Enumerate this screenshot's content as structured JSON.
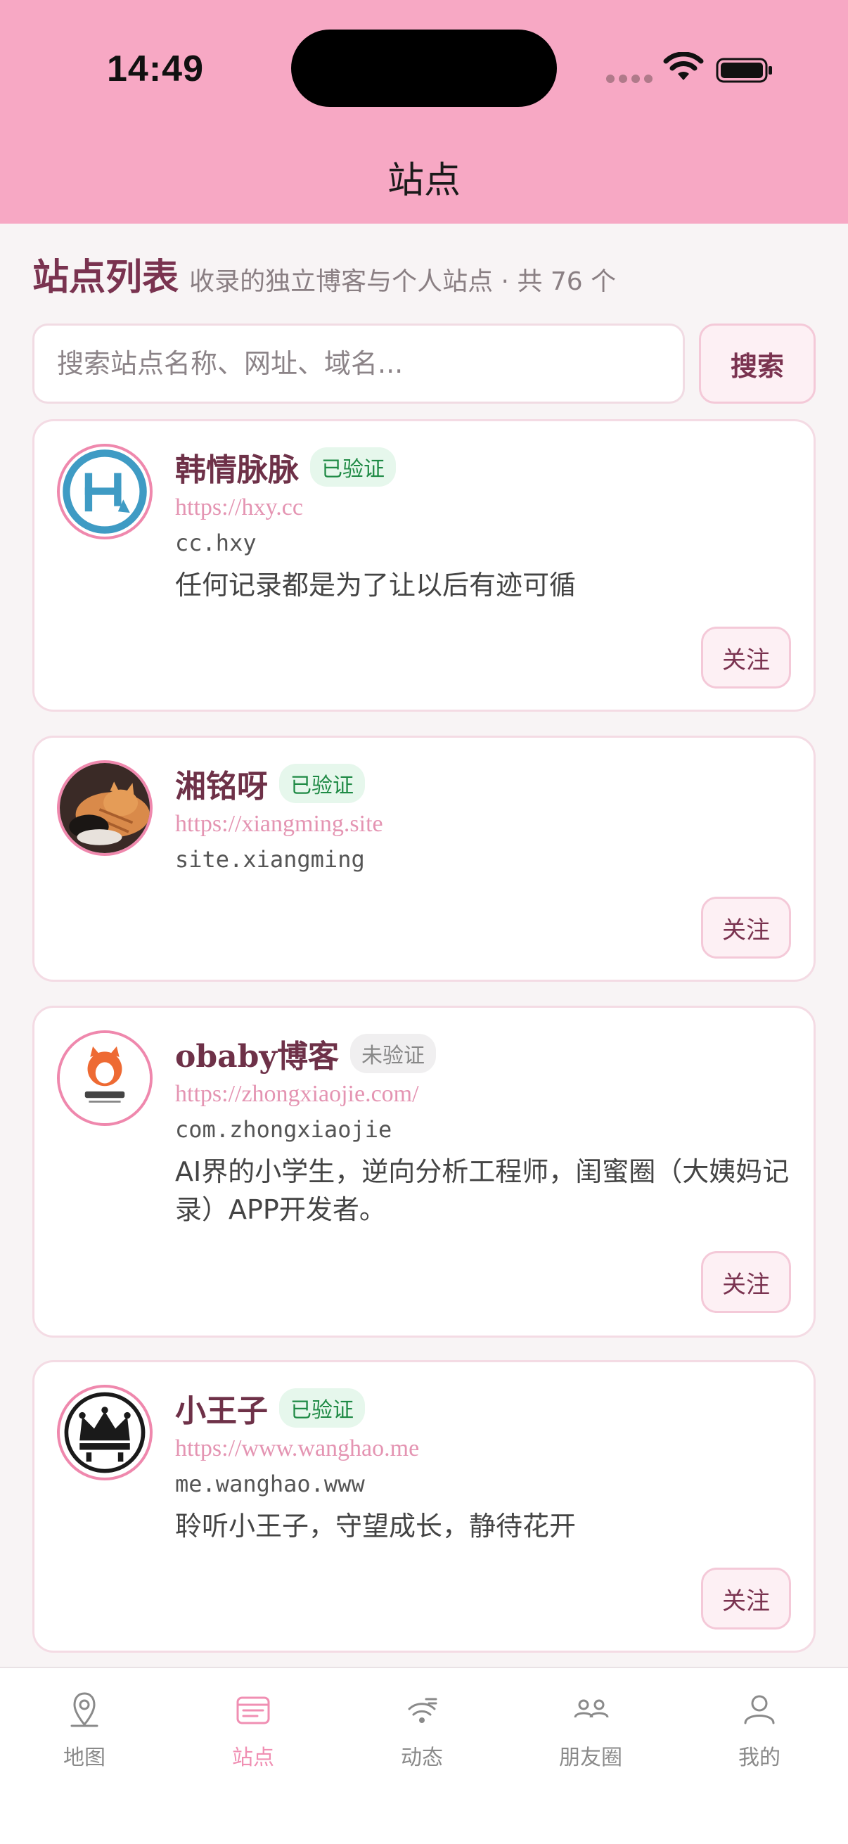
{
  "status": {
    "time": "14:49"
  },
  "nav": {
    "title": "站点"
  },
  "header": {
    "title": "站点列表",
    "subtitle": "收录的独立博客与个人站点 · 共 76 个"
  },
  "search": {
    "placeholder": "搜索站点名称、网址、域名...",
    "button_label": "搜索"
  },
  "sites": [
    {
      "name": "韩情脉脉",
      "badge": "已验证",
      "url": "https://hxy.cc",
      "domain": "cc.hxy",
      "description": "任何记录都是为了让以后有迹可循",
      "follow_label": "关注",
      "avatar": "hxy-logo"
    },
    {
      "name": "湘铭呀",
      "badge": "已验证",
      "url": "https://xiangming.site",
      "domain": "site.xiangming",
      "description": "",
      "follow_label": "关注",
      "avatar": "cat-photo"
    },
    {
      "name": "obaby博客",
      "badge": "未验证",
      "url": "https://zhongxiaojie.com/",
      "domain": "com.zhongxiaojie",
      "description": "AI界的小学生，逆向分析工程师，闺蜜圈（大姨妈记录）APP开发者。",
      "follow_label": "关注",
      "avatar": "obaby-logo"
    },
    {
      "name": "小王子",
      "badge": "已验证",
      "url": "https://www.wanghao.me",
      "domain": "me.wanghao.www",
      "description": "聆听小王子，守望成长，静待花开",
      "follow_label": "关注",
      "avatar": "crown-logo"
    }
  ],
  "colors": {
    "brand_pink": "#f7a8c4",
    "title_plum": "#7a3350",
    "verified_green": "#1f8a45"
  },
  "tabs": [
    {
      "label": "地图",
      "icon": "map-pin-icon",
      "active": false
    },
    {
      "label": "站点",
      "icon": "sites-icon",
      "active": true
    },
    {
      "label": "动态",
      "icon": "feed-icon",
      "active": false
    },
    {
      "label": "朋友圈",
      "icon": "friends-icon",
      "active": false
    },
    {
      "label": "我的",
      "icon": "profile-icon",
      "active": false
    }
  ]
}
